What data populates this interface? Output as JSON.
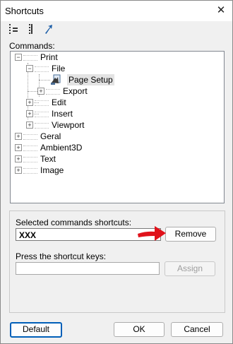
{
  "window": {
    "title": "Shortcuts",
    "close_symbol": "✕"
  },
  "toolbar": {
    "buttons": [
      {
        "icon": "tree-expand-icon"
      },
      {
        "icon": "tree-collapse-icon"
      },
      {
        "icon": "jump-arrow-icon"
      }
    ]
  },
  "commands": {
    "label": "Commands:",
    "tree": [
      {
        "label": "Print",
        "expander": "−"
      },
      {
        "label": "File",
        "expander": "−"
      },
      {
        "label": "Page Setup",
        "selected": true
      },
      {
        "label": "Export",
        "expander": "+"
      },
      {
        "label": "Edit",
        "expander": "+"
      },
      {
        "label": "Insert",
        "expander": "+"
      },
      {
        "label": "Viewport",
        "expander": "+"
      },
      {
        "label": "Geral",
        "expander": "+"
      },
      {
        "label": "Ambient3D",
        "expander": "+"
      },
      {
        "label": "Text",
        "expander": "+"
      },
      {
        "label": "Image",
        "expander": "+"
      }
    ]
  },
  "selected_shortcuts": {
    "label": "Selected commands shortcuts:",
    "value": "XXX",
    "remove_label": "Remove"
  },
  "press_keys": {
    "label": "Press the shortcut keys:",
    "value": "",
    "assign_label": "Assign"
  },
  "footer": {
    "default_label": "Default",
    "ok_label": "OK",
    "cancel_label": "Cancel"
  },
  "colors": {
    "accent": "#005fb8",
    "annotation_arrow": "#e0121b"
  }
}
